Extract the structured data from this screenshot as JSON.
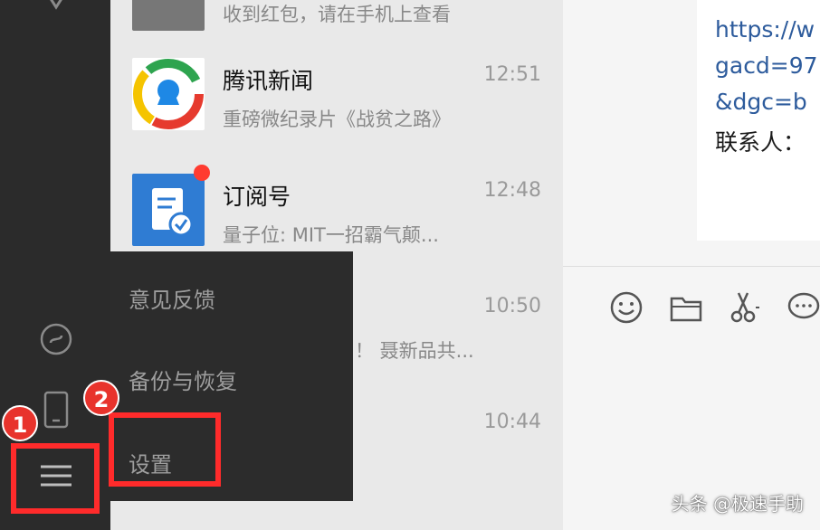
{
  "conversations": [
    {
      "name": "",
      "time": "",
      "preview": "收到红包，请在手机上查看",
      "unread": false,
      "avatar_icon": "photo-avatar"
    },
    {
      "name": "腾讯新闻",
      "time": "12:51",
      "preview": "重磅微纪录片《战贫之路》",
      "unread": false,
      "avatar_icon": "tencent-news-icon"
    },
    {
      "name": "订阅号",
      "time": "12:48",
      "preview": "量子位: MIT一招霸气颠...",
      "unread": true,
      "avatar_icon": "subscription-icon"
    },
    {
      "name": "",
      "time": "10:50",
      "preview": "！ 聂新品共...",
      "unread": false,
      "avatar_icon": ""
    },
    {
      "name": "",
      "time": "10:44",
      "preview": "",
      "unread": false,
      "avatar_icon": ""
    }
  ],
  "chat": {
    "lines": [
      "https://w",
      "gacd=97",
      "&dgc=b",
      "联系人："
    ]
  },
  "menu": {
    "items": [
      "意见反馈",
      "备份与恢复",
      "设置"
    ]
  },
  "annotations": {
    "step1": "1",
    "step2": "2"
  },
  "watermark": "头条 @极速手助",
  "colors": {
    "sidebar": "#2b2b2b",
    "list_bg": "#e9e9e9",
    "menu_bg": "#2c2c2c",
    "highlight": "#ff2b2b",
    "link": "#2d5b9c",
    "unread_dot": "#ff3b30"
  }
}
